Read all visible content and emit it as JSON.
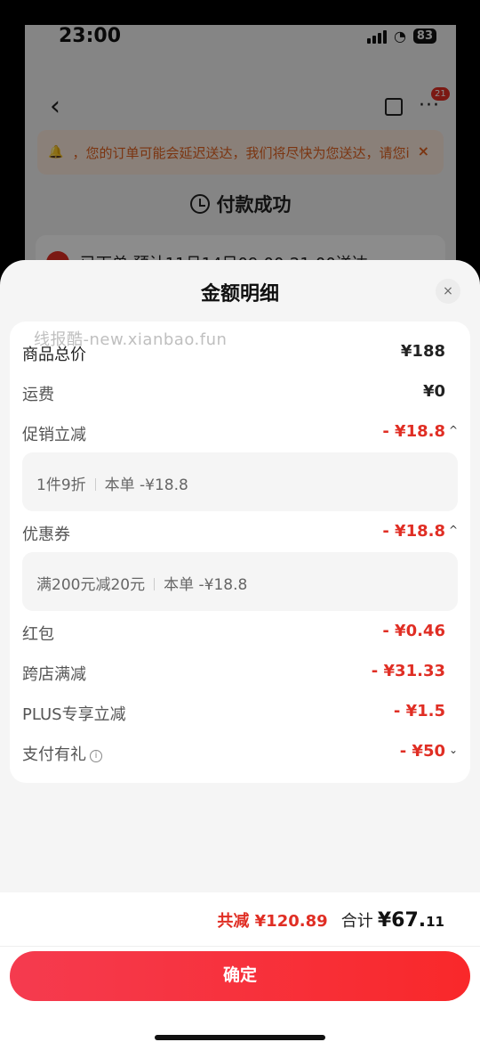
{
  "status_bar": {
    "time": "23:00",
    "battery": "83"
  },
  "background": {
    "more_badge": "21",
    "notice_text": "，您的订单可能会延迟送达，我们将尽快为您送达，请您i",
    "notice_close": "×",
    "pay_success": "付款成功",
    "order_text": "已下单 预计11月14日09:00-21:00送达"
  },
  "sheet": {
    "title": "金额明细",
    "close": "×",
    "watermark": "线报酷-new.xianbao.fun",
    "rows": {
      "goods_total": {
        "label": "商品总价",
        "value": "¥188"
      },
      "shipping": {
        "label": "运费",
        "value": "¥0"
      },
      "promo": {
        "label": "促销立减",
        "value": "- ¥18.8",
        "chevron": "^"
      },
      "promo_detail": {
        "left": "1件9折",
        "right": "本单 -¥18.8"
      },
      "coupon": {
        "label": "优惠券",
        "value": "- ¥18.8",
        "chevron": "^"
      },
      "coupon_detail": {
        "left": "满200元减20元",
        "right": "本单 -¥18.8"
      },
      "red_packet": {
        "label": "红包",
        "value": "- ¥0.46"
      },
      "cross_store": {
        "label": "跨店满减",
        "value": "- ¥31.33"
      },
      "plus": {
        "label": "PLUS专享立减",
        "value": "- ¥1.5"
      },
      "pay_gift": {
        "label": "支付有礼",
        "info": "i",
        "value": "- ¥50",
        "chevron": "⌄"
      }
    }
  },
  "footer": {
    "save_text": "共减 ¥120.89",
    "total_label": "合计",
    "total_main": "¥67.",
    "total_cents": "11",
    "confirm": "确定"
  },
  "colors": {
    "accent": "#e02e24",
    "button_start": "#f53b4f",
    "button_end": "#f9282a"
  }
}
